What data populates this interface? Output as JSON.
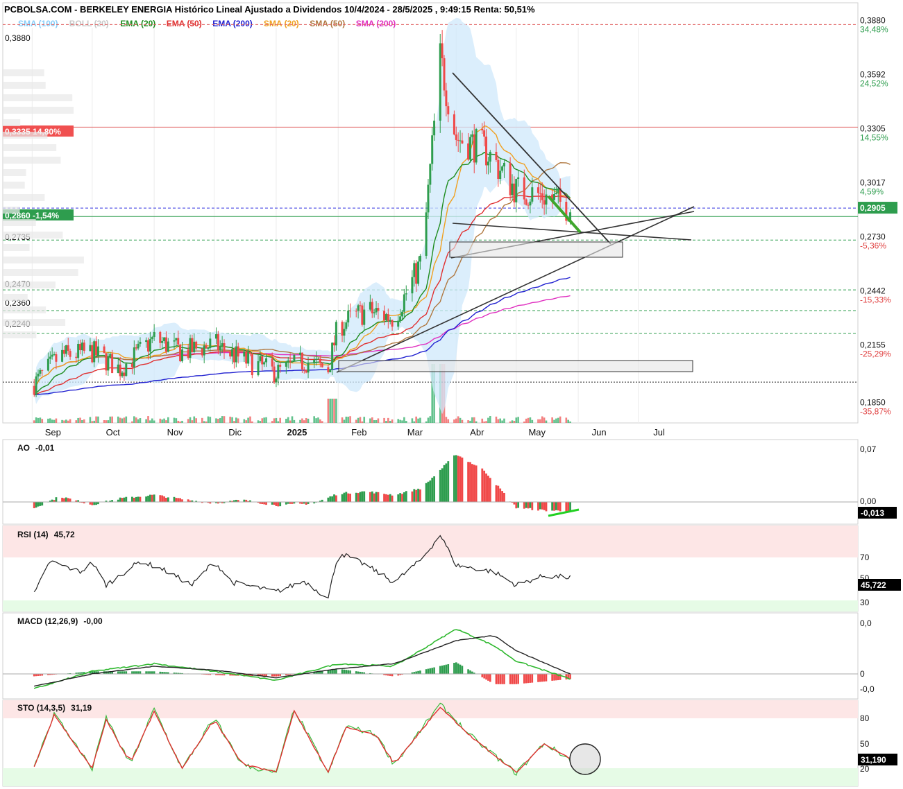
{
  "title": "PCBOLSA.COM - BERKELEY ENERGIA Histórico Lineal Ajustado a Dividendos 10/4/2024 - 28/5/2025 , 9:49:15 Renta: 50,51%",
  "legend": [
    {
      "label": "SMA (100)",
      "color": "#87cefa"
    },
    {
      "label": "BOLL (20)",
      "color": "#c8c8c8"
    },
    {
      "label": "EMA (20)",
      "color": "#1e8c1e"
    },
    {
      "label": "EMA (50)",
      "color": "#e03030"
    },
    {
      "label": "EMA (200)",
      "color": "#2020d0"
    },
    {
      "label": "SMA (20)",
      "color": "#f0a020"
    },
    {
      "label": "SMA (50)",
      "color": "#b07840"
    },
    {
      "label": "SMA (200)",
      "color": "#e030c0"
    }
  ],
  "price_axis": {
    "levels": [
      {
        "value": "0,3880",
        "pct": "34,48%",
        "pct_color": "#2e9d4e"
      },
      {
        "value": "0,3592",
        "pct": "24,52%",
        "pct_color": "#2e9d4e"
      },
      {
        "value": "0,3305",
        "pct": "14,55%",
        "pct_color": "#2e9d4e"
      },
      {
        "value": "0,3017",
        "pct": "4,59%",
        "pct_color": "#2e9d4e"
      },
      {
        "value": "0,2730",
        "pct": "-5,36%",
        "pct_color": "#e04040"
      },
      {
        "value": "0,2442",
        "pct": "-15,33%",
        "pct_color": "#e04040"
      },
      {
        "value": "0,2155",
        "pct": "-25,29%",
        "pct_color": "#e04040"
      },
      {
        "value": "0,1850",
        "pct": "-35,87%",
        "pct_color": "#e04040"
      }
    ],
    "current_price": "0,2905",
    "left_labels": [
      {
        "text": "0,3880"
      },
      {
        "text": "0,3335  14,80%",
        "badge": true,
        "color": "#f05050"
      },
      {
        "text": "0,2860  -1,54%",
        "badge": true,
        "color": "#2e9d4e"
      },
      {
        "text": "0,2735"
      },
      {
        "text": "0,2470"
      },
      {
        "text": "0,2360"
      },
      {
        "text": "0,2240"
      }
    ]
  },
  "months": [
    "Sep",
    "Oct",
    "Nov",
    "Dic",
    "2025",
    "Feb",
    "Mar",
    "Abr",
    "May",
    "Jun",
    "Jul"
  ],
  "chart_data": [
    {
      "type": "candlestick",
      "title": "BERKELEY ENERGIA",
      "ylim": [
        0.18,
        0.39
      ],
      "reference_lines": [
        0.388,
        0.3335,
        0.2905,
        0.286,
        0.2735,
        0.247,
        0.236,
        0.224,
        0.198
      ],
      "close_approx": [
        {
          "date": "2024-09-01",
          "close": 0.196
        },
        {
          "date": "2024-09-15",
          "close": 0.212
        },
        {
          "date": "2024-10-01",
          "close": 0.214
        },
        {
          "date": "2024-10-15",
          "close": 0.205
        },
        {
          "date": "2024-11-01",
          "close": 0.221
        },
        {
          "date": "2024-11-15",
          "close": 0.214
        },
        {
          "date": "2024-12-01",
          "close": 0.218
        },
        {
          "date": "2024-12-15",
          "close": 0.21
        },
        {
          "date": "2025-01-01",
          "close": 0.203
        },
        {
          "date": "2025-01-15",
          "close": 0.209
        },
        {
          "date": "2025-01-27",
          "close": 0.205
        },
        {
          "date": "2025-02-01",
          "close": 0.228
        },
        {
          "date": "2025-02-15",
          "close": 0.236
        },
        {
          "date": "2025-03-01",
          "close": 0.232
        },
        {
          "date": "2025-03-15",
          "close": 0.263
        },
        {
          "date": "2025-03-24",
          "close": 0.37
        },
        {
          "date": "2025-04-01",
          "close": 0.328
        },
        {
          "date": "2025-04-15",
          "close": 0.322
        },
        {
          "date": "2025-05-01",
          "close": 0.3
        },
        {
          "date": "2025-05-15",
          "close": 0.297
        },
        {
          "date": "2025-05-28",
          "close": 0.2905
        }
      ]
    },
    {
      "type": "bar",
      "title": "AO",
      "current_label": "-0,01",
      "axis_labels": [
        "0,07",
        "0,00"
      ],
      "current_value": "-0,013",
      "ylim": [
        -0.02,
        0.075
      ],
      "values_approx": [
        {
          "date": "2024-09-01",
          "value": -0.01
        },
        {
          "date": "2024-09-15",
          "value": 0.008
        },
        {
          "date": "2024-10-01",
          "value": -0.004
        },
        {
          "date": "2024-10-15",
          "value": 0.005
        },
        {
          "date": "2024-11-01",
          "value": 0.01
        },
        {
          "date": "2024-11-15",
          "value": 0.004
        },
        {
          "date": "2024-12-01",
          "value": -0.002
        },
        {
          "date": "2024-12-15",
          "value": 0.003
        },
        {
          "date": "2025-01-01",
          "value": -0.005
        },
        {
          "date": "2025-01-20",
          "value": -0.002
        },
        {
          "date": "2025-02-01",
          "value": 0.012
        },
        {
          "date": "2025-02-15",
          "value": 0.015
        },
        {
          "date": "2025-03-01",
          "value": 0.01
        },
        {
          "date": "2025-03-15",
          "value": 0.02
        },
        {
          "date": "2025-04-01",
          "value": 0.068
        },
        {
          "date": "2025-04-15",
          "value": 0.045
        },
        {
          "date": "2025-05-01",
          "value": -0.008
        },
        {
          "date": "2025-05-15",
          "value": -0.012
        },
        {
          "date": "2025-05-28",
          "value": -0.013
        }
      ]
    },
    {
      "type": "line",
      "title": "RSI (14)",
      "current_label": "45,72",
      "axis_labels": [
        "70",
        "50",
        "30"
      ],
      "current_value": "45,722",
      "ylim": [
        20,
        85
      ],
      "values_approx": [
        {
          "date": "2024-09-01",
          "value": 30
        },
        {
          "date": "2024-09-10",
          "value": 58
        },
        {
          "date": "2024-09-25",
          "value": 50
        },
        {
          "date": "2024-10-01",
          "value": 57
        },
        {
          "date": "2024-10-08",
          "value": 40
        },
        {
          "date": "2024-10-25",
          "value": 58
        },
        {
          "date": "2024-11-05",
          "value": 52
        },
        {
          "date": "2024-11-20",
          "value": 40
        },
        {
          "date": "2024-12-01",
          "value": 58
        },
        {
          "date": "2024-12-10",
          "value": 42
        },
        {
          "date": "2025-01-01",
          "value": 35
        },
        {
          "date": "2025-01-15",
          "value": 43
        },
        {
          "date": "2025-01-27",
          "value": 30
        },
        {
          "date": "2025-02-01",
          "value": 65
        },
        {
          "date": "2025-02-15",
          "value": 55
        },
        {
          "date": "2025-03-01",
          "value": 42
        },
        {
          "date": "2025-03-15",
          "value": 60
        },
        {
          "date": "2025-03-24",
          "value": 78
        },
        {
          "date": "2025-04-01",
          "value": 55
        },
        {
          "date": "2025-04-20",
          "value": 50
        },
        {
          "date": "2025-05-01",
          "value": 40
        },
        {
          "date": "2025-05-15",
          "value": 47
        },
        {
          "date": "2025-05-28",
          "value": 45.72
        }
      ]
    },
    {
      "type": "line",
      "title": "MACD (12,26,9)",
      "current_label": "-0,00",
      "axis_labels": [
        "0,0",
        "0",
        "-0,0"
      ],
      "ylim": [
        -0.012,
        0.04
      ],
      "series": [
        {
          "values_approx": [
            {
              "date": "2024-09-01",
              "value": -0.012
            },
            {
              "date": "2024-10-01",
              "value": 0.002
            },
            {
              "date": "2024-11-01",
              "value": 0.008
            },
            {
              "date": "2024-12-01",
              "value": 0.002
            },
            {
              "date": "2025-01-01",
              "value": -0.005
            },
            {
              "date": "2025-02-01",
              "value": 0.008
            },
            {
              "date": "2025-03-01",
              "value": 0.006
            },
            {
              "date": "2025-04-01",
              "value": 0.035
            },
            {
              "date": "2025-04-20",
              "value": 0.022
            },
            {
              "date": "2025-05-01",
              "value": 0.01
            },
            {
              "date": "2025-05-28",
              "value": -0.004
            }
          ]
        },
        {
          "values_approx": [
            {
              "date": "2024-09-01",
              "value": -0.01
            },
            {
              "date": "2024-10-01",
              "value": 0.0
            },
            {
              "date": "2024-11-01",
              "value": 0.006
            },
            {
              "date": "2024-12-01",
              "value": 0.003
            },
            {
              "date": "2025-01-01",
              "value": -0.003
            },
            {
              "date": "2025-02-01",
              "value": 0.004
            },
            {
              "date": "2025-03-01",
              "value": 0.008
            },
            {
              "date": "2025-04-01",
              "value": 0.026
            },
            {
              "date": "2025-04-20",
              "value": 0.03
            },
            {
              "date": "2025-05-01",
              "value": 0.018
            },
            {
              "date": "2025-05-28",
              "value": 0.0
            }
          ]
        }
      ]
    },
    {
      "type": "line",
      "title": "STO (14,3,5)",
      "current_label": "31,19",
      "axis_labels": [
        "80",
        "50",
        "20"
      ],
      "current_value": "31,190",
      "ylim": [
        0,
        100
      ],
      "values_approx": [
        {
          "date": "2024-09-01",
          "value": 15
        },
        {
          "date": "2024-09-12",
          "value": 85
        },
        {
          "date": "2024-09-25",
          "value": 40
        },
        {
          "date": "2024-10-01",
          "value": 20
        },
        {
          "date": "2024-10-08",
          "value": 80
        },
        {
          "date": "2024-10-20",
          "value": 25
        },
        {
          "date": "2024-11-01",
          "value": 90
        },
        {
          "date": "2024-11-15",
          "value": 20
        },
        {
          "date": "2024-12-01",
          "value": 80
        },
        {
          "date": "2024-12-15",
          "value": 25
        },
        {
          "date": "2025-01-01",
          "value": 15
        },
        {
          "date": "2025-01-10",
          "value": 90
        },
        {
          "date": "2025-01-27",
          "value": 15
        },
        {
          "date": "2025-02-05",
          "value": 70
        },
        {
          "date": "2025-02-20",
          "value": 60
        },
        {
          "date": "2025-03-01",
          "value": 25
        },
        {
          "date": "2025-03-24",
          "value": 95
        },
        {
          "date": "2025-04-10",
          "value": 55
        },
        {
          "date": "2025-05-01",
          "value": 15
        },
        {
          "date": "2025-05-15",
          "value": 50
        },
        {
          "date": "2025-05-28",
          "value": 31.19
        }
      ]
    }
  ]
}
